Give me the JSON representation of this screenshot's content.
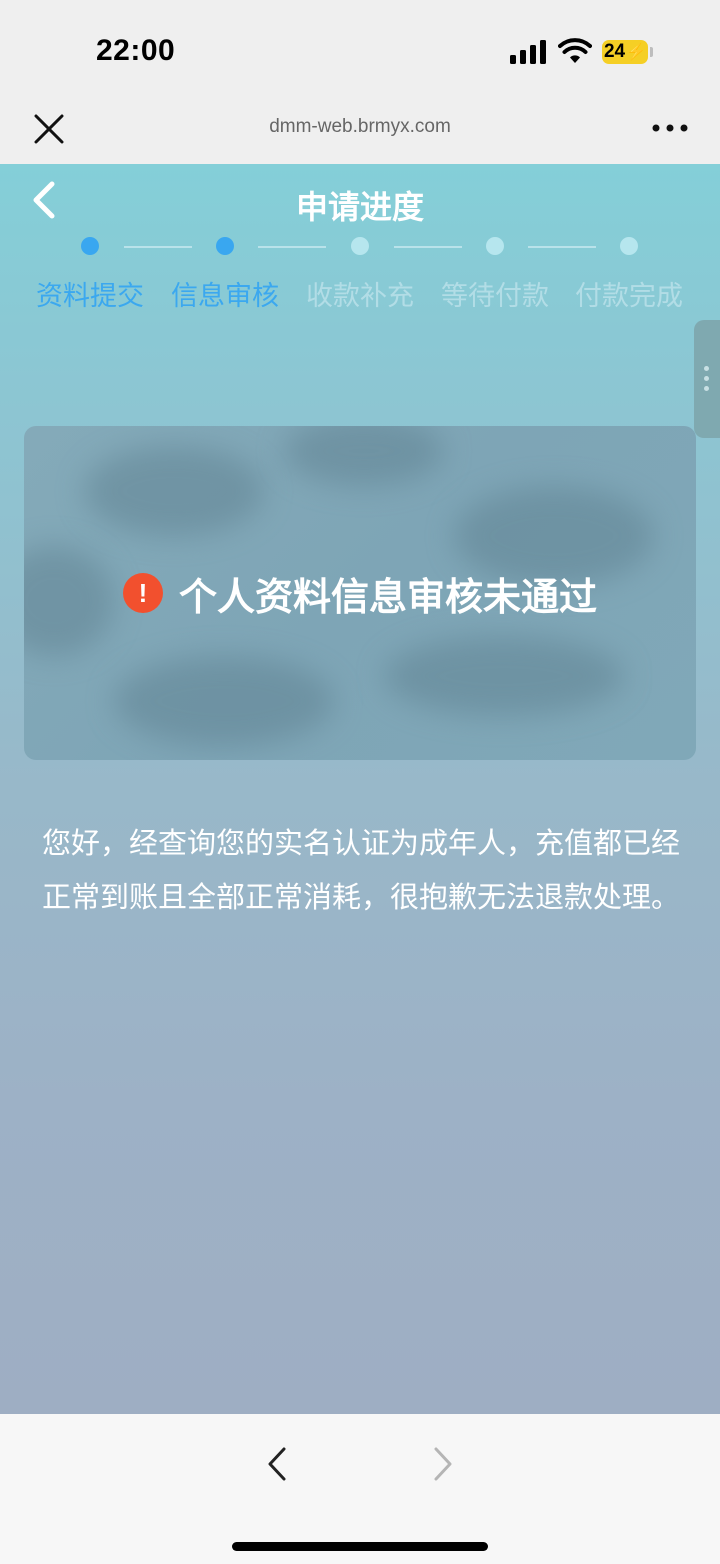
{
  "status_bar": {
    "time": "22:00",
    "battery": "24"
  },
  "browser": {
    "url": "dmm-web.brmyx.com"
  },
  "header": {
    "title": "申请进度"
  },
  "steps": [
    {
      "label": "资料提交",
      "state": "active"
    },
    {
      "label": "信息审核",
      "state": "active"
    },
    {
      "label": "收款补充",
      "state": "inactive"
    },
    {
      "label": "等待付款",
      "state": "inactive"
    },
    {
      "label": "付款完成",
      "state": "inactive"
    }
  ],
  "result": {
    "icon": "warning-icon",
    "text": "个人资料信息审核未通过"
  },
  "message": "您好，经查询您的实名认证为成年人，充值都已经正常到账且全部正常消耗，很抱歉无法退款处理。",
  "colors": {
    "accent": "#39a7f0",
    "warning": "#f2502e"
  }
}
